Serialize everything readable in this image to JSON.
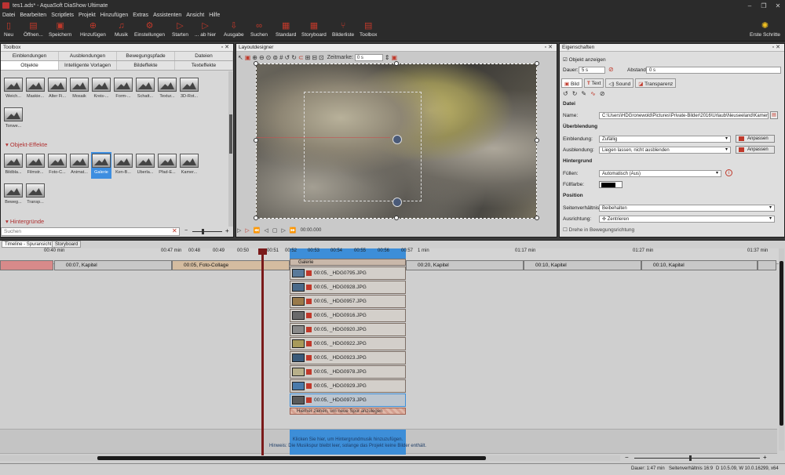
{
  "window": {
    "title": "tes1.ads* - AquaSoft DiaShow Ultimate"
  },
  "menu": [
    "Datei",
    "Bearbeiten",
    "Scriptlets",
    "Projekt",
    "Hinzufügen",
    "Extras",
    "Assistenten",
    "Ansicht",
    "Hilfe"
  ],
  "ribbon": {
    "new": "Neu",
    "open": "Öffnen...",
    "save": "Speichern",
    "add": "Hinzufügen",
    "music": "Musik",
    "settings": "Einstellungen",
    "start": "Starten",
    "from_here": "... ab hier",
    "output": "Ausgabe",
    "search": "Suchen",
    "standard": "Standard",
    "storyboard": "Storyboard",
    "image_list": "Bilderliste",
    "toolbox": "Toolbox",
    "first_steps": "Erste Schritte"
  },
  "toolbox": {
    "title": "Toolbox",
    "tabs1": [
      "Einblendungen",
      "Ausblendungen",
      "Bewegungspfade",
      "Dateien"
    ],
    "tabs2": [
      "Objekte",
      "Intelligente Vorlagen",
      "Bildeffekte",
      "Texteffekte"
    ],
    "objects": [
      "Weich...",
      "Maskie...",
      "Alter Fi...",
      "Mosaik",
      "Kreis-...",
      "Form-...",
      "Schatt...",
      "Textur...",
      "3D-Rot...",
      "Tonwe..."
    ],
    "section_effects": "Objekt-Effekte",
    "effects": [
      "Bildbla...",
      "Filmstr...",
      "Foto-C...",
      "Animat...",
      "Galerie",
      "Ken-B...",
      "Überla...",
      "Pfad-E...",
      "Kamer...",
      "Beweg...",
      "Transp..."
    ],
    "section_bg": "Hintergründe",
    "search_placeholder": "Suchen"
  },
  "layout": {
    "title": "Layoutdesigner",
    "time_label": "Zeitmarke:",
    "time_value": "0 s",
    "play_time": "00:00.000"
  },
  "props": {
    "title": "Eigenschaften",
    "show_object": "Objekt anzeigen",
    "duration_label": "Dauer:",
    "duration_value": "5 s",
    "spacing_label": "Abstand:",
    "spacing_value": "0 s",
    "tabs": [
      "Bild",
      "Text",
      "Sound",
      "Transparenz"
    ],
    "file_section": "Datei",
    "name_label": "Name:",
    "name_value": "C:\\Users\\HDGronewold\\Pictures\\Private-Bilder\\2016\\Urlaub\\Neuseeland\\Kamera-Ha",
    "transition_section": "Überblendung",
    "fade_in_label": "Einblendung:",
    "fade_in_value": "Zufällig",
    "fade_out_label": "Ausblendung:",
    "fade_out_value": "Liegen lassen, nicht ausblenden",
    "adjust": "Anpassen",
    "bg_section": "Hintergrund",
    "fill_label": "Füllen:",
    "fill_value": "Automatisch (Aus)",
    "fillcolor_label": "Füllfarbe:",
    "pos_section": "Position",
    "aspect_label": "Seitenverhältnis:",
    "aspect_value": "Beibehalten",
    "align_label": "Ausrichtung:",
    "align_value": "Zentrieren",
    "rotate_label": "Drehe in Bewegungsrichtung"
  },
  "timeline": {
    "tab1": "Timeline - Spuransicht",
    "tab2": "Storyboard",
    "ticks": [
      {
        "label": "00:40 min"
      },
      {
        "label": "00:47 min"
      },
      {
        "label": "00:48"
      },
      {
        "label": "00:49"
      },
      {
        "label": "00:50"
      },
      {
        "label": "00:51"
      },
      {
        "label": "00:52"
      },
      {
        "label": "00:53"
      },
      {
        "label": "00:54"
      },
      {
        "label": "00:55"
      },
      {
        "label": "00:56"
      },
      {
        "label": "00:57"
      },
      {
        "label": "1 min"
      },
      {
        "label": "01:17 min"
      },
      {
        "label": "01:27 min"
      },
      {
        "label": "01:37 min"
      }
    ],
    "clips": [
      "00:07, Kapitel",
      "00:05, Foto-Collage",
      "00:20, Kapitel",
      "00:10, Kapitel",
      "00:10, Kapitel"
    ],
    "gallery_title": "Galerie",
    "gallery_items": [
      "00:05, _HDG0795.JPG",
      "00:05, _HDG0928.JPG",
      "00:05, _HDG0957.JPG",
      "00:05, _HDG0916.JPG",
      "00:05, _HDG0920.JPG",
      "00:05, _HDG0922.JPG",
      "00:05, _HDG0923.JPG",
      "00:05, _HDG0978.JPG",
      "00:05, _HDG0929.JPG",
      "00:05, _HDG0973.JPG"
    ],
    "drop_hint": "Hierher ziehen, um neue Spur anzulegen",
    "music_hint1": "Klicken Sie hier, um Hintergrundmusik hinzuzufügen.",
    "music_hint2": "Hinweis: Die Musikspur bleibt leer, solange das Projekt keine Bilder enthält."
  },
  "status": {
    "duration": "Dauer: 1:47 min",
    "aspect": "Seitenverhältnis 16:9",
    "version": "D 10.5.09, W 10.0.16299, x64"
  },
  "colors": {
    "accent": "#c0392b",
    "selection": "#3d8ee0",
    "gallery_band": "#3d8ed8",
    "playhead": "#7a1a1a"
  }
}
